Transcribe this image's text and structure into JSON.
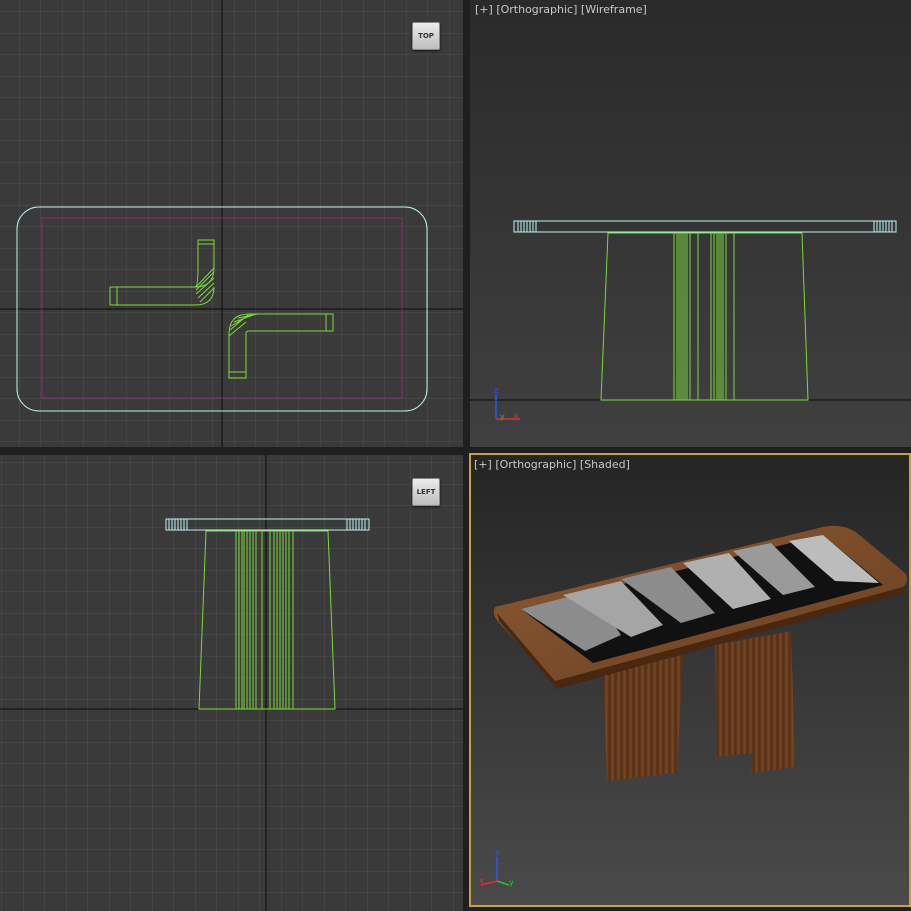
{
  "viewports": {
    "top": {
      "viewcube": "TOP"
    },
    "front": {
      "label_plus": "[+]",
      "label_view": "[Orthographic]",
      "label_mode": "[Wireframe]"
    },
    "left": {
      "viewcube": "LEFT"
    },
    "perspective": {
      "label_plus": "[+]",
      "label_view": "[Orthographic]",
      "label_mode": "[Shaded]"
    }
  },
  "axes": {
    "x": "x",
    "y": "y",
    "z": "z"
  },
  "colors": {
    "viewport_bg": "#3a3a3a",
    "grid_line": "#4f4f4f",
    "grid_axis": "#0a0a0a",
    "wire_green": "#7ad93a",
    "wire_cyan": "#bff2f2",
    "wire_magenta": "#8a2d6e",
    "active_border": "#c8a040",
    "wood": "#6a3e20",
    "axis_x": "#e03030",
    "axis_y": "#30c030",
    "axis_z": "#3050ff"
  },
  "icons": [
    "viewcube-icon",
    "axis-tripod-icon"
  ]
}
